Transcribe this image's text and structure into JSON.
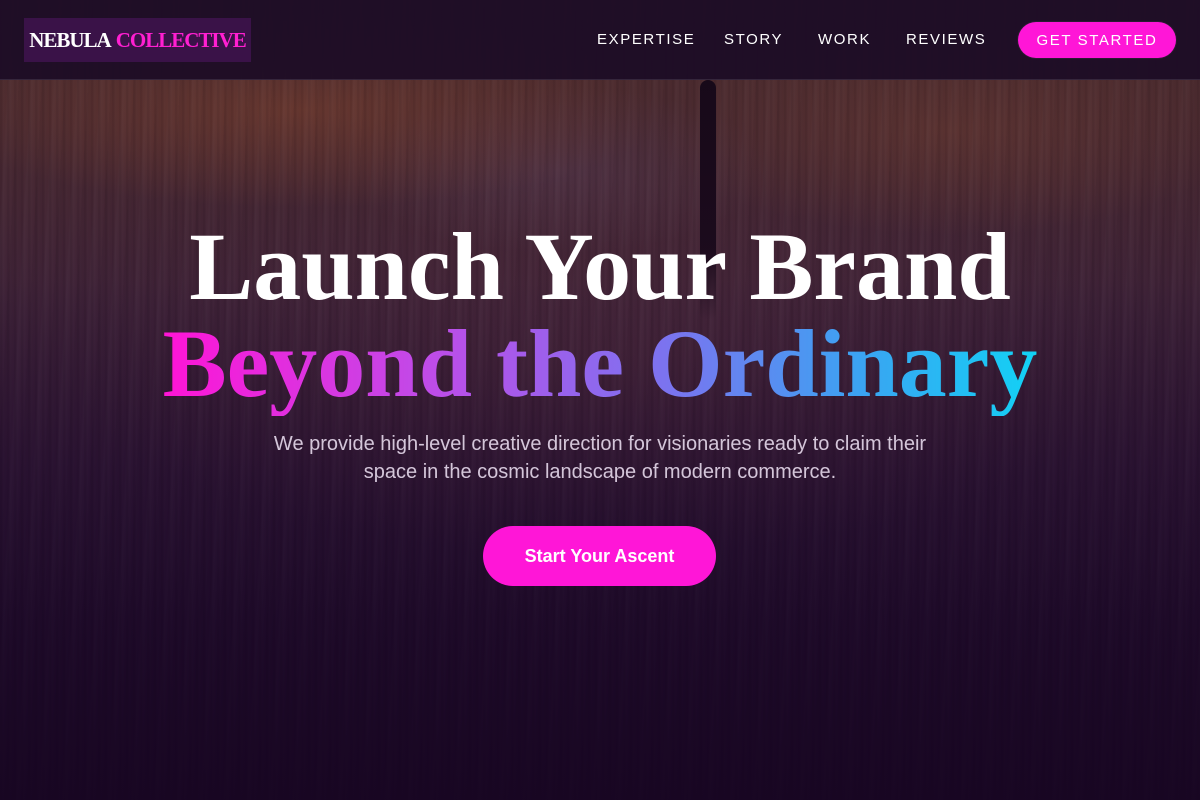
{
  "brand": {
    "word1": "NEBULA",
    "word2": "COLLECTIVE",
    "accent_color": "#ff16d7"
  },
  "nav": {
    "items": [
      {
        "label": "EXPERTISE"
      },
      {
        "label": "STORY"
      },
      {
        "label": "WORK"
      },
      {
        "label": "REVIEWS"
      }
    ],
    "cta_label": "GET STARTED"
  },
  "hero": {
    "headline_line1": "Launch Your Brand",
    "headline_line2": "Beyond the Ordinary",
    "headline_gradient": [
      "#ff14d6",
      "#7a74ef",
      "#12d2f5"
    ],
    "subtext": "We provide high-level creative direction for visionaries ready to claim their space in the cosmic landscape of modern commerce.",
    "cta_label": "Start Your Ascent"
  }
}
